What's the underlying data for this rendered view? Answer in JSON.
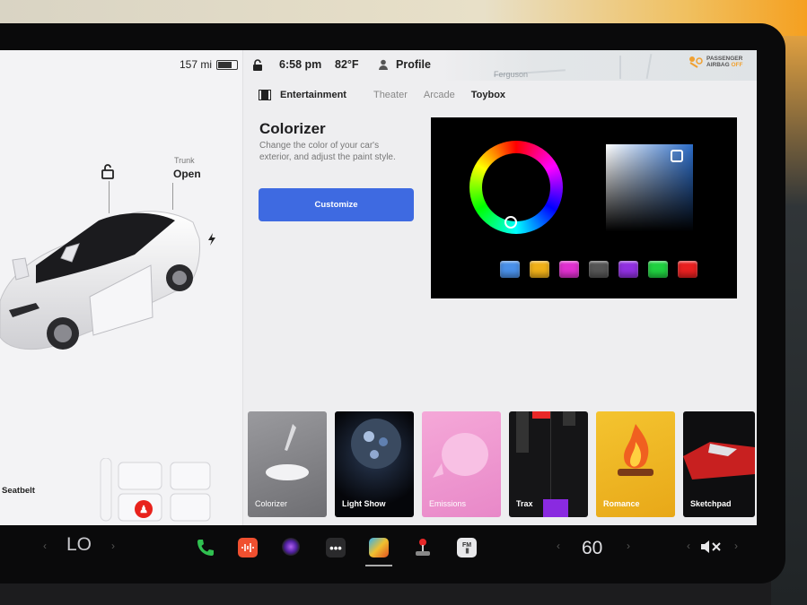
{
  "status": {
    "range": "157 mi",
    "time": "6:58 pm",
    "temp": "82°F",
    "profile": "Profile",
    "airbag_line1": "PASSENGER",
    "airbag_line2": "AIRBAG",
    "airbag_line3": "OFF",
    "map_street": "Ferguson"
  },
  "car": {
    "trunk_label": "Trunk",
    "trunk_state": "Open",
    "seatbelt": "Seatbelt"
  },
  "tabs": {
    "section": "Entertainment",
    "items": [
      "Theater",
      "Arcade",
      "Toybox"
    ],
    "active": "Toybox"
  },
  "colorizer": {
    "title": "Colorizer",
    "description": "Change the color of your car's exterior, and adjust the paint style.",
    "button": "Customize",
    "swatch_colors": [
      "#4a90e8",
      "#f0b018",
      "#e030d0",
      "#555555",
      "#9030e0",
      "#20d040",
      "#e82020"
    ]
  },
  "tiles": [
    {
      "label": "Colorizer"
    },
    {
      "label": "Light Show"
    },
    {
      "label": "Emissions"
    },
    {
      "label": "Trax"
    },
    {
      "label": "Romance"
    },
    {
      "label": "Sketchpad"
    }
  ],
  "dock": {
    "left_temp": "LO",
    "right_temp": "60",
    "fm_label": "FM"
  },
  "colors": {
    "accent": "#3e6ae1",
    "screen_bg": "#eeeef0"
  }
}
